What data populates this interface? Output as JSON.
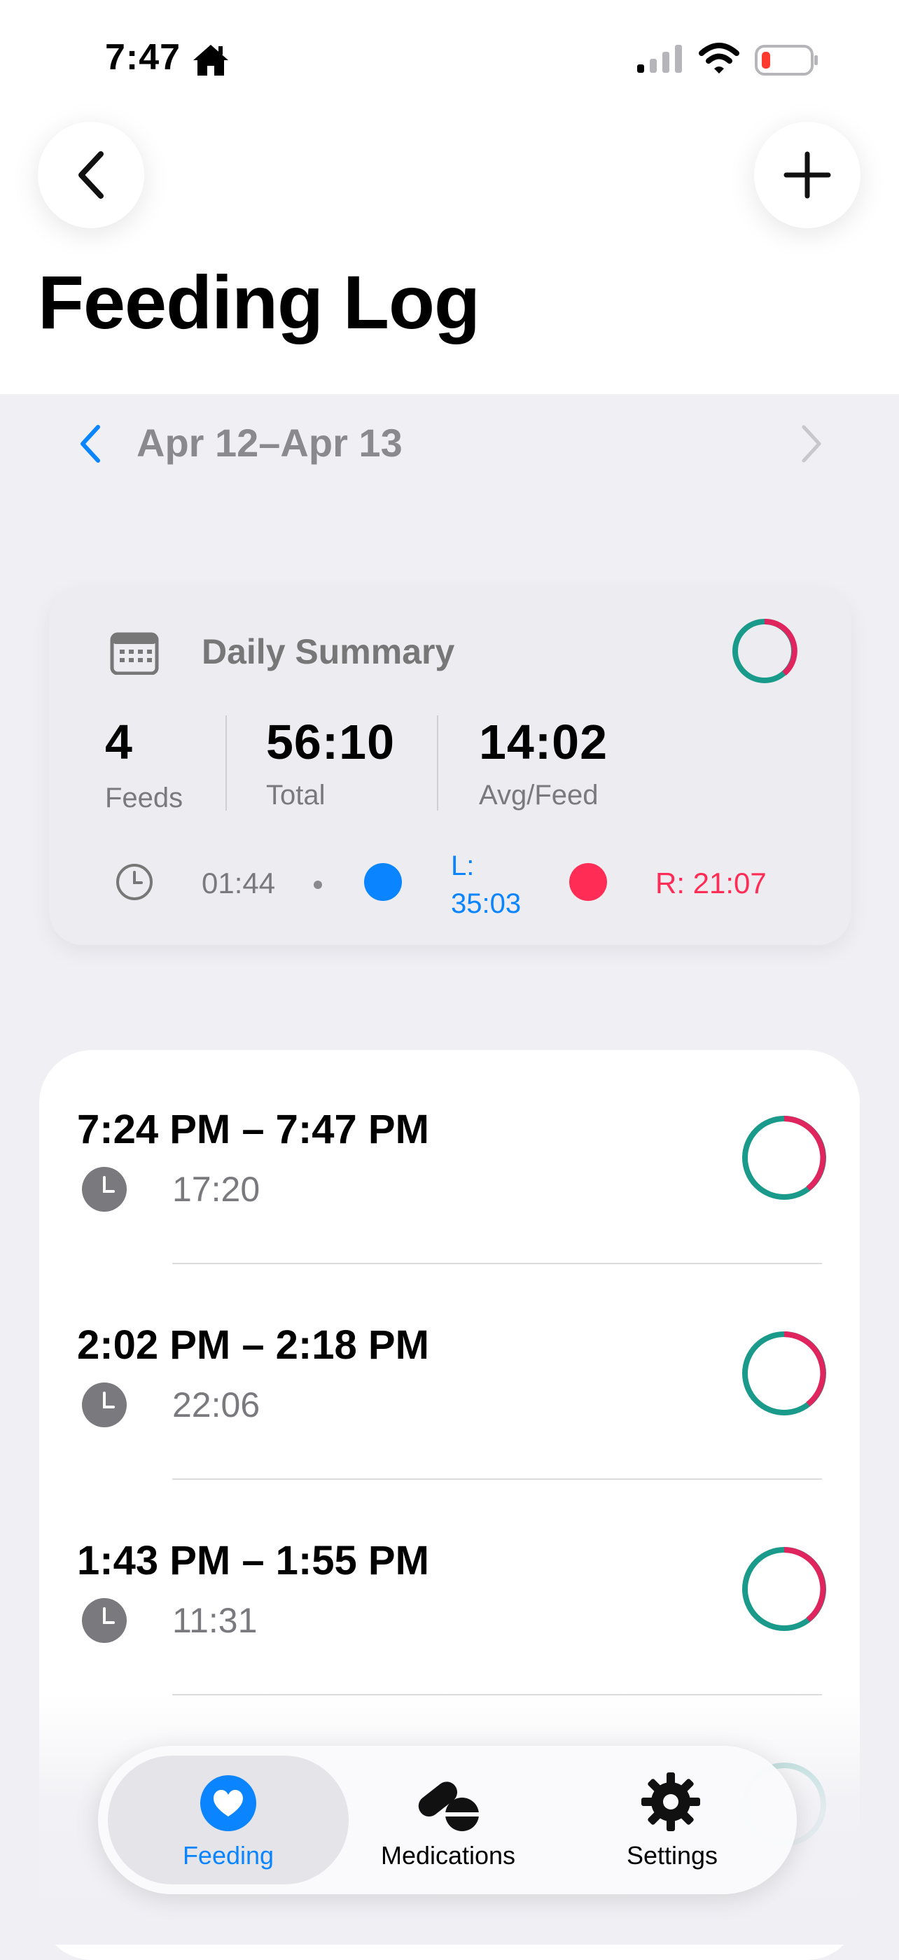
{
  "status_bar": {
    "time": "7:47"
  },
  "header": {
    "title": "Feeding Log"
  },
  "date_nav": {
    "range": "Apr 12–Apr 13"
  },
  "summary": {
    "title": "Daily Summary",
    "feeds": {
      "value": "4",
      "label": "Feeds"
    },
    "total": {
      "value": "56:10",
      "label": "Total"
    },
    "avg": {
      "value": "14:02",
      "label": "Avg/Feed"
    },
    "interval": "01:44",
    "left": "L:\n35:03",
    "right": "R: 21:07",
    "colors": {
      "left": "#0a84ff",
      "right": "#ff2d55",
      "ring_teal": "#1a9a8a",
      "ring_pink": "#e0245e"
    }
  },
  "feeds": [
    {
      "time_range": "7:24 PM – 7:47 PM",
      "duration": "17:20",
      "left_fraction": 0.6
    },
    {
      "time_range": "2:02 PM – 2:18 PM",
      "duration": "22:06",
      "left_fraction": 0.6
    },
    {
      "time_range": "1:43 PM – 1:55 PM",
      "duration": "11:31",
      "left_fraction": 0.6
    }
  ],
  "tabbar": {
    "tabs": [
      {
        "label": "Feeding",
        "icon": "heart-icon",
        "selected": true
      },
      {
        "label": "Medications",
        "icon": "pills-icon",
        "selected": false
      },
      {
        "label": "Settings",
        "icon": "gear-icon",
        "selected": false
      }
    ]
  }
}
